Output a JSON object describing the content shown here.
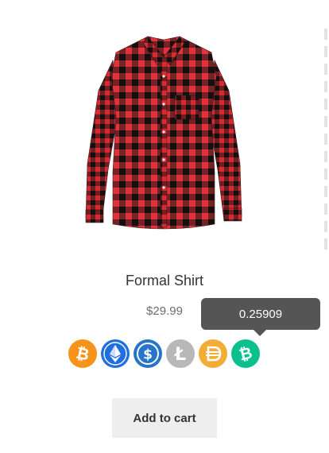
{
  "product": {
    "title": "Formal Shirt",
    "price": "$29.99",
    "image_icon": "plaid-shirt-image",
    "shirt_colors": {
      "base": "#d8242c",
      "check": "#1a1414"
    }
  },
  "crypto": {
    "tooltip_value": "0.25909",
    "coins": [
      {
        "name": "bitcoin-icon",
        "symbol": "₿",
        "color": "#f7931a"
      },
      {
        "name": "ethereum-icon",
        "symbol": "Ξ",
        "color": "#1f6fe0"
      },
      {
        "name": "usd-coin-icon",
        "symbol": "$",
        "color": "#2775ca"
      },
      {
        "name": "litecoin-icon",
        "symbol": "Ł",
        "color": "#b8b8b8"
      },
      {
        "name": "dai-icon",
        "symbol": "Đ",
        "color": "#f5ac37"
      },
      {
        "name": "bitcoin-cash-icon",
        "symbol": "₿",
        "color": "#0ac18e"
      }
    ]
  },
  "cart": {
    "add_label": "Add to cart"
  }
}
